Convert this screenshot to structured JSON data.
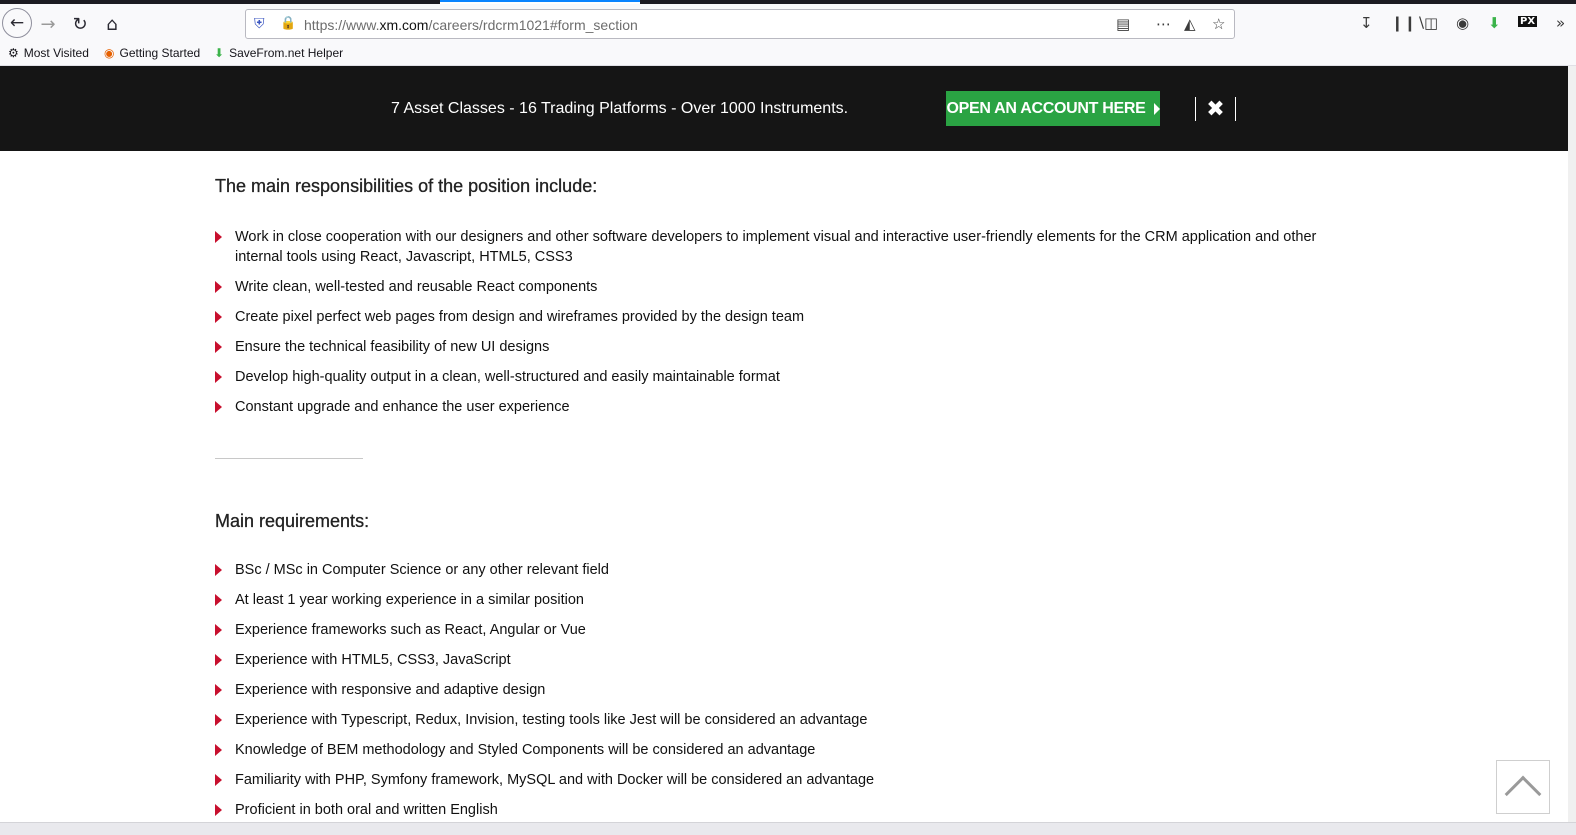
{
  "browser": {
    "url_prefix": "https://www.",
    "url_domain": "xm.com",
    "url_path": "/careers/rdcrm1021#form_section",
    "icons": [
      "back-icon",
      "forward-icon",
      "reload-icon",
      "home-icon",
      "shield-icon",
      "lock-icon",
      "reader-icon",
      "more-icon",
      "pocket-icon",
      "star-icon",
      "download-icon",
      "library-icon",
      "sidebar-icon",
      "account-icon",
      "savefrom-icon",
      "px-icon"
    ]
  },
  "bookmarks": {
    "most_visited": "Most Visited",
    "getting_started": "Getting Started",
    "savefrom": "SaveFrom.net Helper"
  },
  "promo": {
    "text": "7 Asset Classes - 16 Trading Platforms - Over 1000 Instruments.",
    "cta": "OPEN AN ACCOUNT HERE",
    "cta_color": "#2aa343",
    "close": "✖"
  },
  "responsibilities": {
    "title": "The main responsibilities of the position include:",
    "items": [
      "Work in close cooperation with our designers and other software developers to implement visual and interactive user-friendly elements for the CRM application and other internal tools using React, Javascript, HTML5, CSS3",
      "Write clean, well-tested and reusable React components",
      "Create pixel perfect web pages from design and wireframes provided by the design team",
      "Ensure the technical feasibility of new UI designs",
      "Develop high-quality output in a clean, well-structured and easily maintainable format",
      "Constant upgrade and enhance the user experience"
    ]
  },
  "requirements": {
    "title": "Main requirements:",
    "items": [
      "BSc / MSc in Computer Science or any other relevant field",
      "At least 1 year working experience in a similar position",
      "Experience frameworks such as React, Angular or Vue",
      "Experience with HTML5, CSS3, JavaScript",
      "Experience with responsive and adaptive design",
      "Experience with Typescript, Redux, Invision, testing tools like Jest will be considered an advantage",
      "Knowledge of BEM methodology and Styled Components will be considered an advantage",
      "Familiarity with PHP, Symfony framework, MySQL and with Docker will be considered an advantage",
      "Proficient in both oral and written English"
    ]
  },
  "colors": {
    "bullet": "#c8102e",
    "banner_bg": "#151515"
  }
}
